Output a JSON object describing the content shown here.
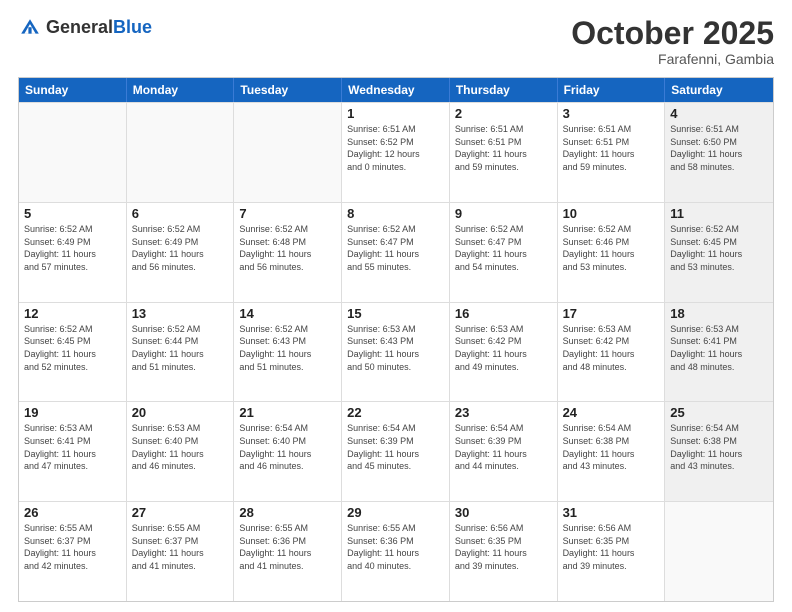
{
  "header": {
    "logo_general": "General",
    "logo_blue": "Blue",
    "month": "October 2025",
    "location": "Farafenni, Gambia"
  },
  "weekdays": [
    "Sunday",
    "Monday",
    "Tuesday",
    "Wednesday",
    "Thursday",
    "Friday",
    "Saturday"
  ],
  "rows": [
    [
      {
        "day": "",
        "info": "",
        "empty": true
      },
      {
        "day": "",
        "info": "",
        "empty": true
      },
      {
        "day": "",
        "info": "",
        "empty": true
      },
      {
        "day": "1",
        "info": "Sunrise: 6:51 AM\nSunset: 6:52 PM\nDaylight: 12 hours\nand 0 minutes.",
        "shaded": false
      },
      {
        "day": "2",
        "info": "Sunrise: 6:51 AM\nSunset: 6:51 PM\nDaylight: 11 hours\nand 59 minutes.",
        "shaded": false
      },
      {
        "day": "3",
        "info": "Sunrise: 6:51 AM\nSunset: 6:51 PM\nDaylight: 11 hours\nand 59 minutes.",
        "shaded": false
      },
      {
        "day": "4",
        "info": "Sunrise: 6:51 AM\nSunset: 6:50 PM\nDaylight: 11 hours\nand 58 minutes.",
        "shaded": true
      }
    ],
    [
      {
        "day": "5",
        "info": "Sunrise: 6:52 AM\nSunset: 6:49 PM\nDaylight: 11 hours\nand 57 minutes.",
        "shaded": false
      },
      {
        "day": "6",
        "info": "Sunrise: 6:52 AM\nSunset: 6:49 PM\nDaylight: 11 hours\nand 56 minutes.",
        "shaded": false
      },
      {
        "day": "7",
        "info": "Sunrise: 6:52 AM\nSunset: 6:48 PM\nDaylight: 11 hours\nand 56 minutes.",
        "shaded": false
      },
      {
        "day": "8",
        "info": "Sunrise: 6:52 AM\nSunset: 6:47 PM\nDaylight: 11 hours\nand 55 minutes.",
        "shaded": false
      },
      {
        "day": "9",
        "info": "Sunrise: 6:52 AM\nSunset: 6:47 PM\nDaylight: 11 hours\nand 54 minutes.",
        "shaded": false
      },
      {
        "day": "10",
        "info": "Sunrise: 6:52 AM\nSunset: 6:46 PM\nDaylight: 11 hours\nand 53 minutes.",
        "shaded": false
      },
      {
        "day": "11",
        "info": "Sunrise: 6:52 AM\nSunset: 6:45 PM\nDaylight: 11 hours\nand 53 minutes.",
        "shaded": true
      }
    ],
    [
      {
        "day": "12",
        "info": "Sunrise: 6:52 AM\nSunset: 6:45 PM\nDaylight: 11 hours\nand 52 minutes.",
        "shaded": false
      },
      {
        "day": "13",
        "info": "Sunrise: 6:52 AM\nSunset: 6:44 PM\nDaylight: 11 hours\nand 51 minutes.",
        "shaded": false
      },
      {
        "day": "14",
        "info": "Sunrise: 6:52 AM\nSunset: 6:43 PM\nDaylight: 11 hours\nand 51 minutes.",
        "shaded": false
      },
      {
        "day": "15",
        "info": "Sunrise: 6:53 AM\nSunset: 6:43 PM\nDaylight: 11 hours\nand 50 minutes.",
        "shaded": false
      },
      {
        "day": "16",
        "info": "Sunrise: 6:53 AM\nSunset: 6:42 PM\nDaylight: 11 hours\nand 49 minutes.",
        "shaded": false
      },
      {
        "day": "17",
        "info": "Sunrise: 6:53 AM\nSunset: 6:42 PM\nDaylight: 11 hours\nand 48 minutes.",
        "shaded": false
      },
      {
        "day": "18",
        "info": "Sunrise: 6:53 AM\nSunset: 6:41 PM\nDaylight: 11 hours\nand 48 minutes.",
        "shaded": true
      }
    ],
    [
      {
        "day": "19",
        "info": "Sunrise: 6:53 AM\nSunset: 6:41 PM\nDaylight: 11 hours\nand 47 minutes.",
        "shaded": false
      },
      {
        "day": "20",
        "info": "Sunrise: 6:53 AM\nSunset: 6:40 PM\nDaylight: 11 hours\nand 46 minutes.",
        "shaded": false
      },
      {
        "day": "21",
        "info": "Sunrise: 6:54 AM\nSunset: 6:40 PM\nDaylight: 11 hours\nand 46 minutes.",
        "shaded": false
      },
      {
        "day": "22",
        "info": "Sunrise: 6:54 AM\nSunset: 6:39 PM\nDaylight: 11 hours\nand 45 minutes.",
        "shaded": false
      },
      {
        "day": "23",
        "info": "Sunrise: 6:54 AM\nSunset: 6:39 PM\nDaylight: 11 hours\nand 44 minutes.",
        "shaded": false
      },
      {
        "day": "24",
        "info": "Sunrise: 6:54 AM\nSunset: 6:38 PM\nDaylight: 11 hours\nand 43 minutes.",
        "shaded": false
      },
      {
        "day": "25",
        "info": "Sunrise: 6:54 AM\nSunset: 6:38 PM\nDaylight: 11 hours\nand 43 minutes.",
        "shaded": true
      }
    ],
    [
      {
        "day": "26",
        "info": "Sunrise: 6:55 AM\nSunset: 6:37 PM\nDaylight: 11 hours\nand 42 minutes.",
        "shaded": false
      },
      {
        "day": "27",
        "info": "Sunrise: 6:55 AM\nSunset: 6:37 PM\nDaylight: 11 hours\nand 41 minutes.",
        "shaded": false
      },
      {
        "day": "28",
        "info": "Sunrise: 6:55 AM\nSunset: 6:36 PM\nDaylight: 11 hours\nand 41 minutes.",
        "shaded": false
      },
      {
        "day": "29",
        "info": "Sunrise: 6:55 AM\nSunset: 6:36 PM\nDaylight: 11 hours\nand 40 minutes.",
        "shaded": false
      },
      {
        "day": "30",
        "info": "Sunrise: 6:56 AM\nSunset: 6:35 PM\nDaylight: 11 hours\nand 39 minutes.",
        "shaded": false
      },
      {
        "day": "31",
        "info": "Sunrise: 6:56 AM\nSunset: 6:35 PM\nDaylight: 11 hours\nand 39 minutes.",
        "shaded": false
      },
      {
        "day": "",
        "info": "",
        "empty": true
      }
    ]
  ]
}
